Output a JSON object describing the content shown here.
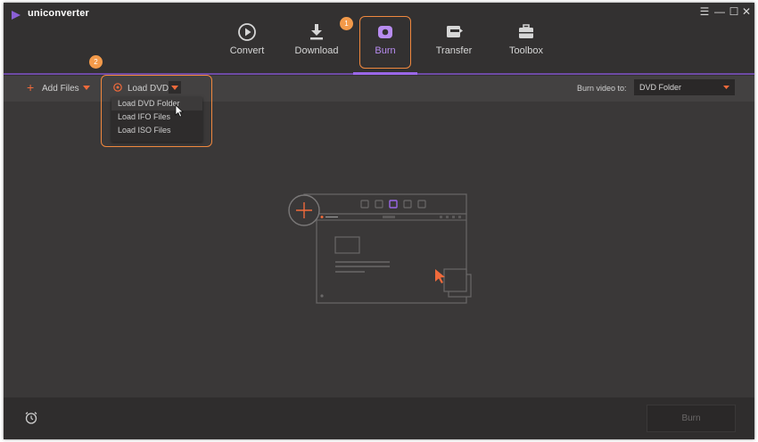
{
  "app": {
    "name": "uniconverter"
  },
  "window_controls": {
    "menu": "☰",
    "minimize": "—",
    "maximize": "☐",
    "close": "✕"
  },
  "nav": {
    "items": [
      {
        "label": "Convert",
        "icon": "convert-icon"
      },
      {
        "label": "Download",
        "icon": "download-icon"
      },
      {
        "label": "Burn",
        "icon": "burn-icon",
        "active": true
      },
      {
        "label": "Transfer",
        "icon": "transfer-icon"
      },
      {
        "label": "Toolbox",
        "icon": "toolbox-icon"
      }
    ]
  },
  "annotations": {
    "step1": "1",
    "step2": "2"
  },
  "toolbar": {
    "add_files": "Add Files",
    "load_dvd": "Load DVD",
    "burn_video_to_label": "Burn video to:",
    "burn_target": "DVD Folder"
  },
  "load_menu": {
    "items": [
      "Load DVD Folder",
      "Load IFO Files",
      "Load ISO Files"
    ]
  },
  "footer": {
    "burn_button": "Burn"
  },
  "colors": {
    "accent": "#9a67e8",
    "highlight": "#f0883e",
    "add_icon": "#f06a3b",
    "background": "#3a3838"
  }
}
